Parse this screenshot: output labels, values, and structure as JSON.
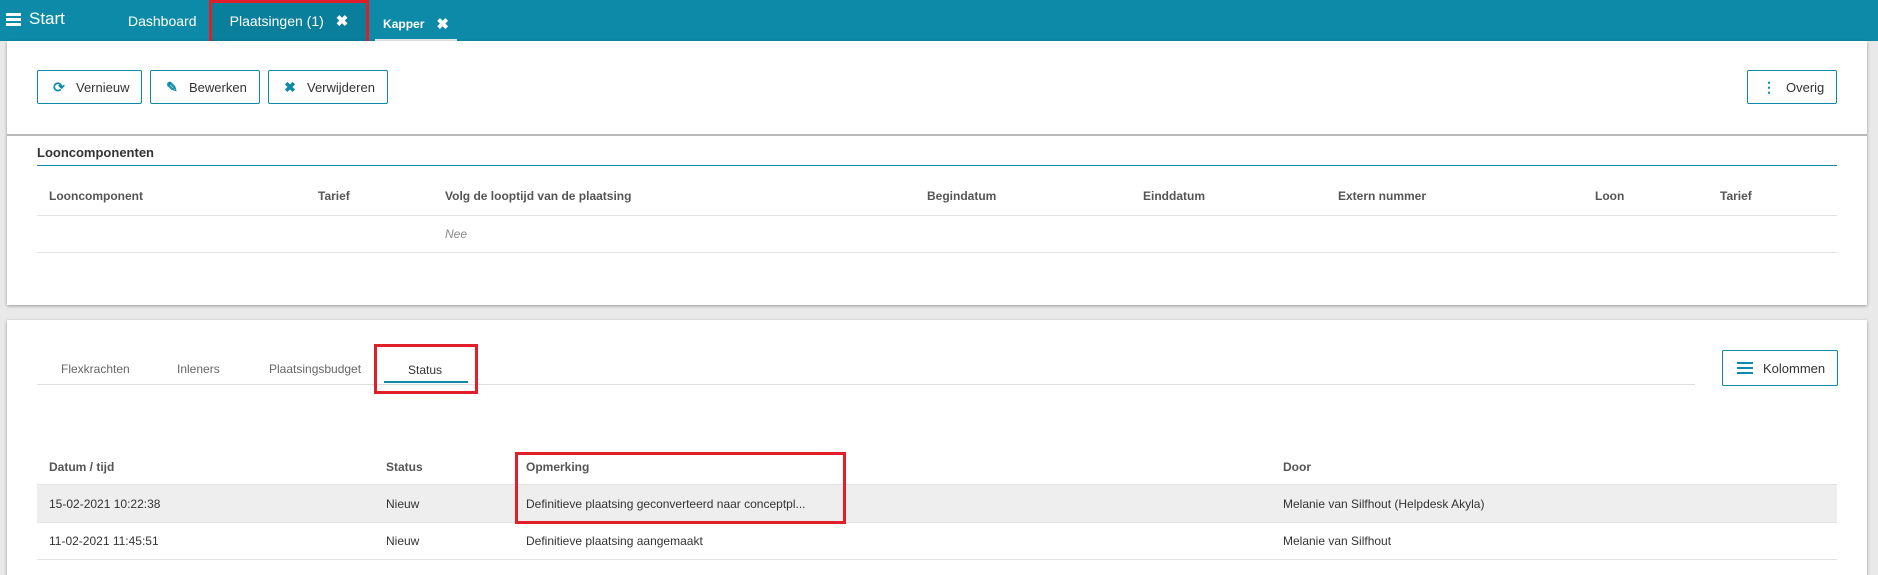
{
  "topbar": {
    "start_label": "Start",
    "tabs": [
      {
        "label": "Dashboard"
      },
      {
        "label": "Plaatsingen (1)",
        "close": "✖"
      },
      {
        "label": "Kapper",
        "close": "✖"
      }
    ]
  },
  "toolbar": {
    "refresh_label": "Vernieuw",
    "edit_label": "Bewerken",
    "delete_label": "Verwijderen",
    "more_label": "Overig"
  },
  "looncomponenten": {
    "title": "Looncomponenten",
    "columns": [
      "Looncomponent",
      "Tarief",
      "Volg de looptijd van de plaatsing",
      "Begindatum",
      "Einddatum",
      "Extern nummer",
      "Loon",
      "Tarief"
    ],
    "rows": [
      [
        "",
        "",
        "Nee",
        "",
        "",
        "",
        "",
        ""
      ]
    ]
  },
  "subtabs": {
    "items": [
      "Flexkrachten",
      "Inleners",
      "Plaatsingsbudget",
      "Status"
    ],
    "active": "Status",
    "columns_button": "Kolommen"
  },
  "status_table": {
    "columns": [
      "Datum / tijd",
      "Status",
      "Opmerking",
      "Door"
    ],
    "rows": [
      [
        "15-02-2021 10:22:38",
        "Nieuw",
        "Definitieve plaatsing geconverteerd naar conceptpl...",
        "Melanie van Silfhout (Helpdesk Akyla)"
      ],
      [
        "11-02-2021 11:45:51",
        "Nieuw",
        "Definitieve plaatsing aangemaakt",
        "Melanie van Silfhout"
      ]
    ]
  },
  "colors": {
    "accent": "#0c8aa8",
    "highlight_box": "#e01f2a"
  }
}
